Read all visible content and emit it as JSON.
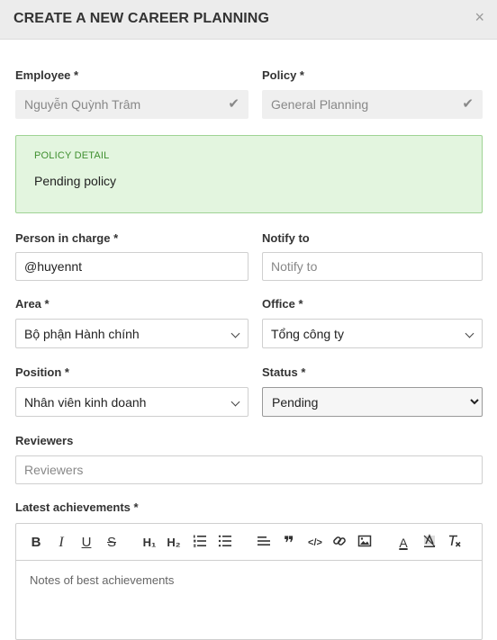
{
  "modal": {
    "title": "CREATE A NEW CAREER PLANNING",
    "close": "×"
  },
  "employee": {
    "label": "Employee *",
    "value": "Nguyễn Quỳnh Trâm"
  },
  "policy": {
    "label": "Policy *",
    "value": "General Planning"
  },
  "policy_detail": {
    "title": "POLICY DETAIL",
    "text": "Pending policy"
  },
  "person_in_charge": {
    "label": "Person in charge *",
    "value": "@huyennt"
  },
  "notify_to": {
    "label": "Notify to",
    "placeholder": "Notify to"
  },
  "area": {
    "label": "Area *",
    "value": "Bộ phận Hành chính"
  },
  "office": {
    "label": "Office *",
    "value": "Tổng công ty"
  },
  "position": {
    "label": "Position *",
    "value": "Nhân viên kinh doanh"
  },
  "status": {
    "label": "Status *",
    "value": "Pending"
  },
  "reviewers": {
    "label": "Reviewers",
    "placeholder": "Reviewers"
  },
  "achievements": {
    "label": "Latest achievements *",
    "placeholder": "Notes of best achievements",
    "toolbar": {
      "bold": "B",
      "italic": "I",
      "underline": "U",
      "strike": "S",
      "h1": "H₁",
      "h2": "H₂",
      "quote": "❞",
      "code": "</>",
      "text_color": "A"
    }
  },
  "colors": {
    "accent_green": "#3f8f2f",
    "policy_bg": "#e3f5df"
  }
}
